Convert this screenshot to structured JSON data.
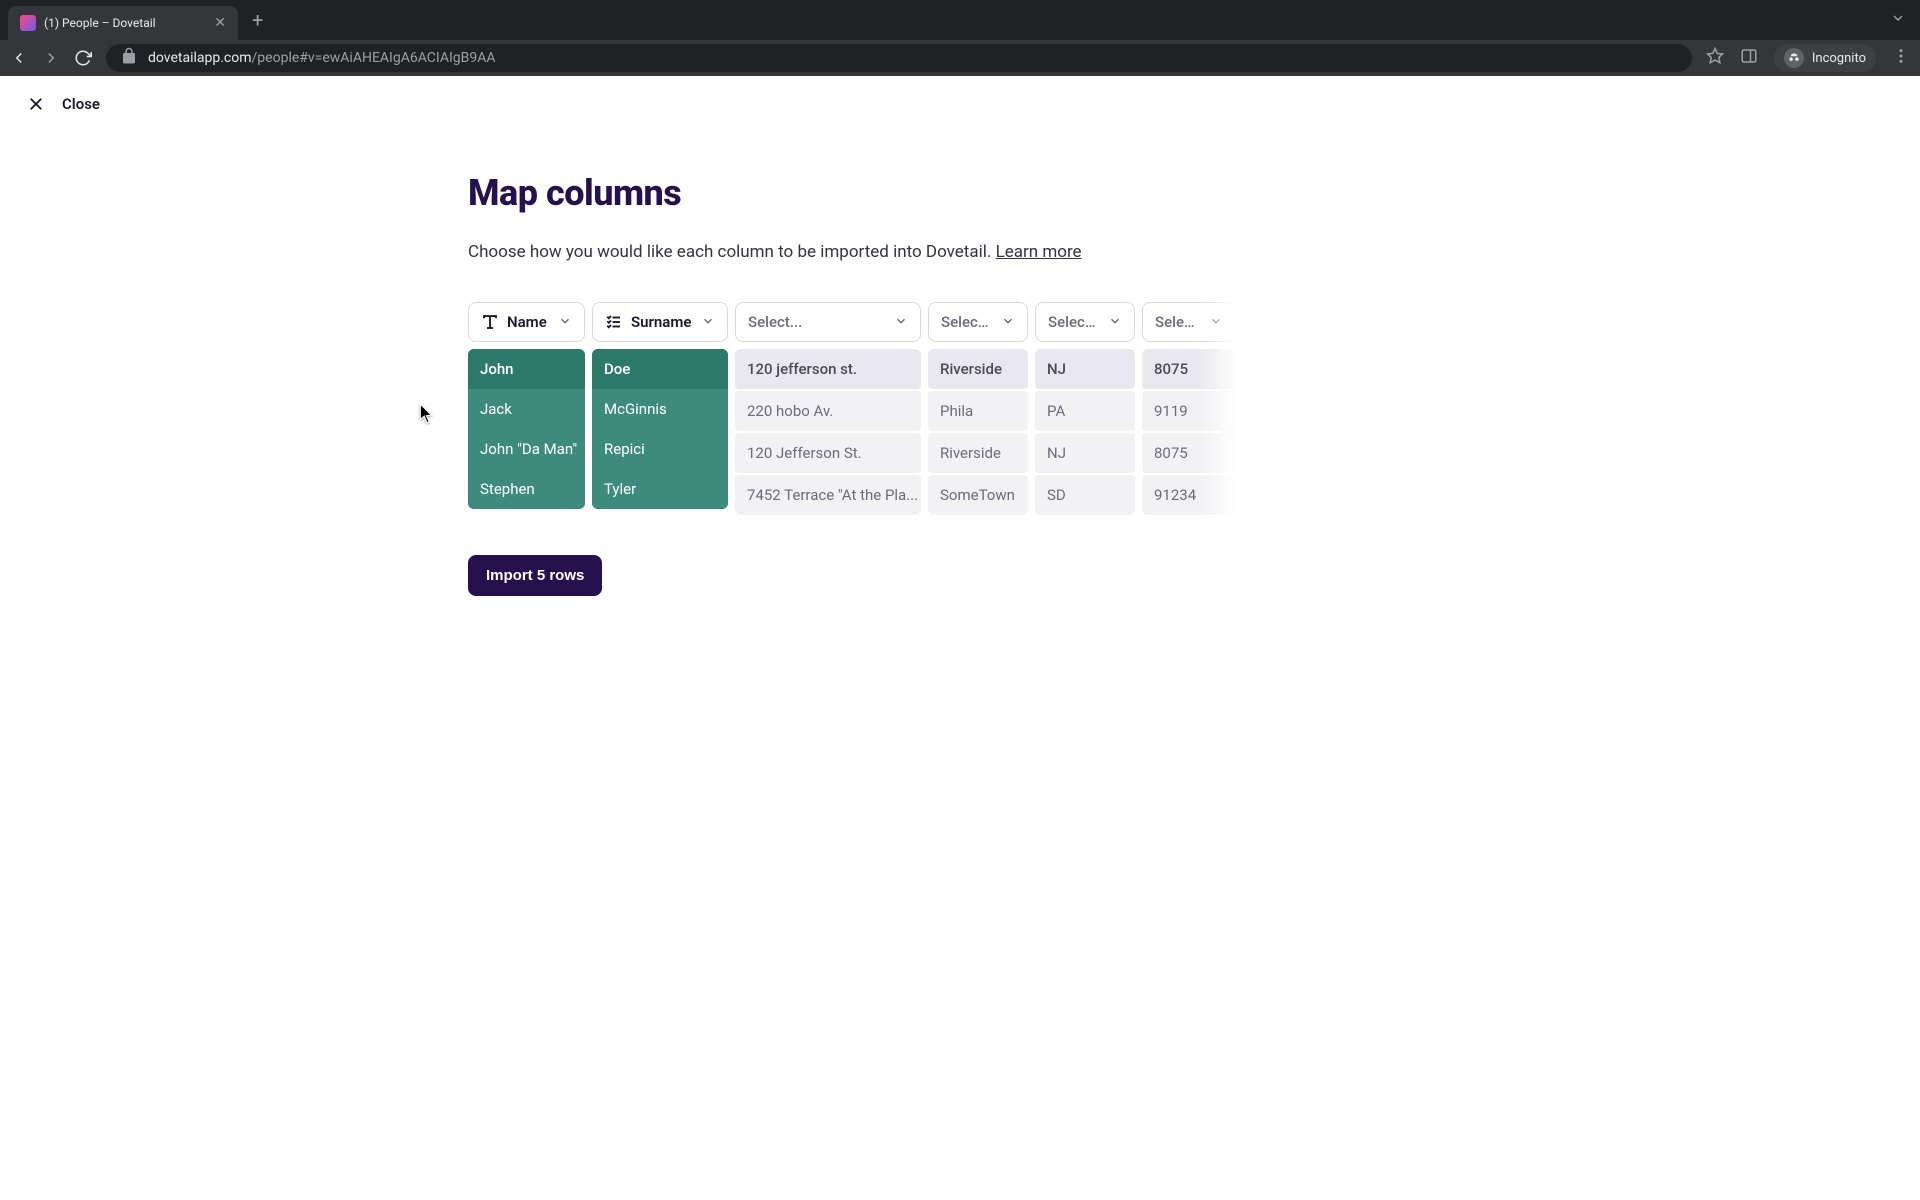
{
  "browser": {
    "tab_title": "(1) People – Dovetail",
    "url_host": "dovetailapp.com",
    "url_path": "/people#v=ewAiAHEAIgA6ACIAIgB9AA",
    "incognito_label": "Incognito"
  },
  "close_label": "Close",
  "page_title": "Map columns",
  "subtitle_text": "Choose how you would like each column to be imported into Dovetail. ",
  "learn_more": "Learn more",
  "select_placeholder": "Select...",
  "columns": [
    {
      "label": "Name",
      "mapped": true,
      "icon": "text",
      "w": "w-name",
      "rows": [
        "John",
        "Jack",
        "John \"Da Man\"",
        "Stephen"
      ]
    },
    {
      "label": "Surname",
      "mapped": true,
      "icon": "list",
      "w": "w-surname",
      "rows": [
        "Doe",
        "McGinnis",
        "Repici",
        "Tyler"
      ]
    },
    {
      "label": "",
      "mapped": false,
      "icon": "",
      "w": "w-addr",
      "rows": [
        "120 jefferson st.",
        "220 hobo Av.",
        "120 Jefferson St.",
        "7452 Terrace \"At the Pla..."
      ]
    },
    {
      "label": "",
      "mapped": false,
      "icon": "",
      "w": "w-city",
      "rows": [
        "Riverside",
        "Phila",
        "Riverside",
        "SomeTown"
      ]
    },
    {
      "label": "",
      "mapped": false,
      "icon": "",
      "w": "w-state",
      "rows": [
        "NJ",
        "PA",
        "NJ",
        "SD"
      ]
    },
    {
      "label": "",
      "mapped": false,
      "icon": "",
      "w": "w-zip",
      "rows": [
        "8075",
        "9119",
        "8075",
        "91234"
      ]
    }
  ],
  "import_button": "Import 5 rows"
}
